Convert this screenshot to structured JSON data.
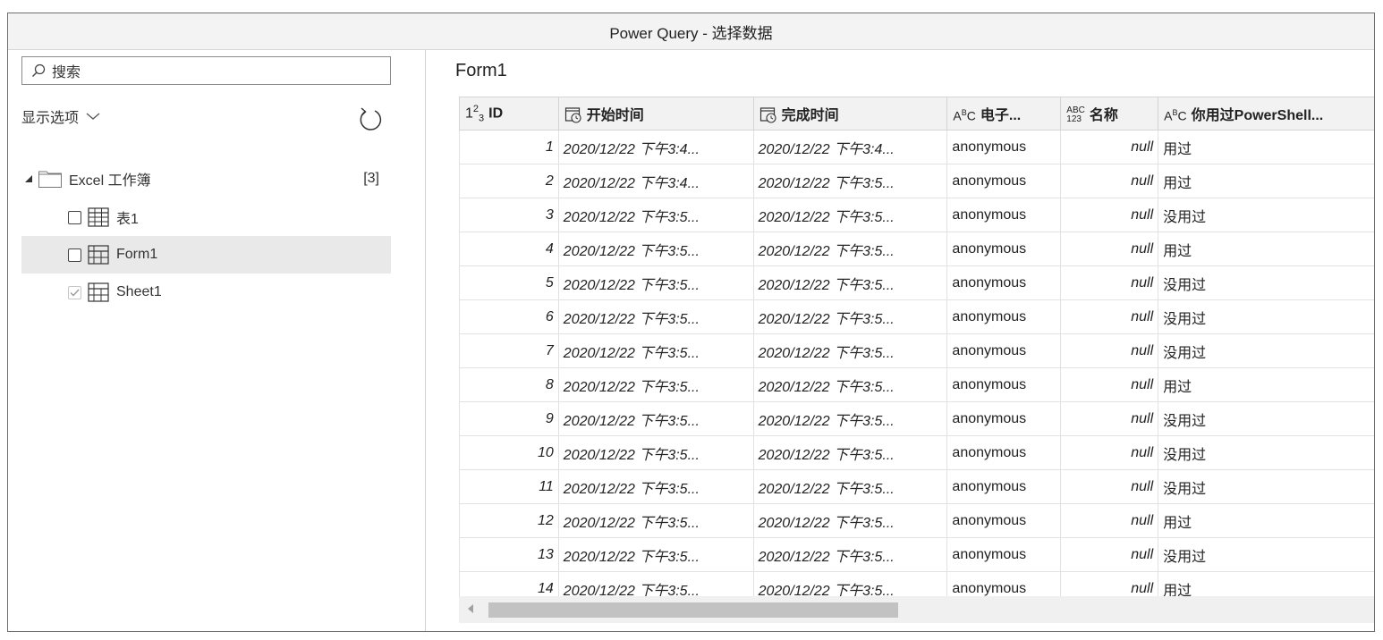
{
  "window": {
    "title": "Power Query - 选择数据"
  },
  "left_panel": {
    "search_placeholder": "搜索",
    "display_options": "显示选项",
    "workbook": {
      "label": "Excel 工作簿",
      "count": "[3]"
    },
    "items": [
      {
        "label": "表1",
        "checked": false,
        "icon": "table-icon"
      },
      {
        "label": "Form1",
        "checked": false,
        "icon": "sheet-icon",
        "selected": true
      },
      {
        "label": "Sheet1",
        "checked": true,
        "icon": "sheet-icon"
      }
    ]
  },
  "preview": {
    "title": "Form1",
    "columns": [
      {
        "type_icon": "1²₃",
        "label": "ID"
      },
      {
        "type_icon": "datetime",
        "label": "开始时间"
      },
      {
        "type_icon": "datetime",
        "label": "完成时间"
      },
      {
        "type_icon": "AᴮC",
        "label": "电子..."
      },
      {
        "type_icon": "ABC 123",
        "label": "名称"
      },
      {
        "type_icon": "AᴮC",
        "label": "你用过PowerShell..."
      }
    ],
    "rows": [
      [
        "1",
        "2020/12/22 下午3:4...",
        "2020/12/22 下午3:4...",
        "anonymous",
        "null",
        "用过"
      ],
      [
        "2",
        "2020/12/22 下午3:4...",
        "2020/12/22 下午3:5...",
        "anonymous",
        "null",
        "用过"
      ],
      [
        "3",
        "2020/12/22 下午3:5...",
        "2020/12/22 下午3:5...",
        "anonymous",
        "null",
        "没用过"
      ],
      [
        "4",
        "2020/12/22 下午3:5...",
        "2020/12/22 下午3:5...",
        "anonymous",
        "null",
        "用过"
      ],
      [
        "5",
        "2020/12/22 下午3:5...",
        "2020/12/22 下午3:5...",
        "anonymous",
        "null",
        "没用过"
      ],
      [
        "6",
        "2020/12/22 下午3:5...",
        "2020/12/22 下午3:5...",
        "anonymous",
        "null",
        "没用过"
      ],
      [
        "7",
        "2020/12/22 下午3:5...",
        "2020/12/22 下午3:5...",
        "anonymous",
        "null",
        "没用过"
      ],
      [
        "8",
        "2020/12/22 下午3:5...",
        "2020/12/22 下午3:5...",
        "anonymous",
        "null",
        "用过"
      ],
      [
        "9",
        "2020/12/22 下午3:5...",
        "2020/12/22 下午3:5...",
        "anonymous",
        "null",
        "没用过"
      ],
      [
        "10",
        "2020/12/22 下午3:5...",
        "2020/12/22 下午3:5...",
        "anonymous",
        "null",
        "没用过"
      ],
      [
        "11",
        "2020/12/22 下午3:5...",
        "2020/12/22 下午3:5...",
        "anonymous",
        "null",
        "没用过"
      ],
      [
        "12",
        "2020/12/22 下午3:5...",
        "2020/12/22 下午3:5...",
        "anonymous",
        "null",
        "用过"
      ],
      [
        "13",
        "2020/12/22 下午3:5...",
        "2020/12/22 下午3:5...",
        "anonymous",
        "null",
        "没用过"
      ],
      [
        "14",
        "2020/12/22 下午3:5...",
        "2020/12/22 下午3:5...",
        "anonymous",
        "null",
        "用过"
      ]
    ]
  }
}
